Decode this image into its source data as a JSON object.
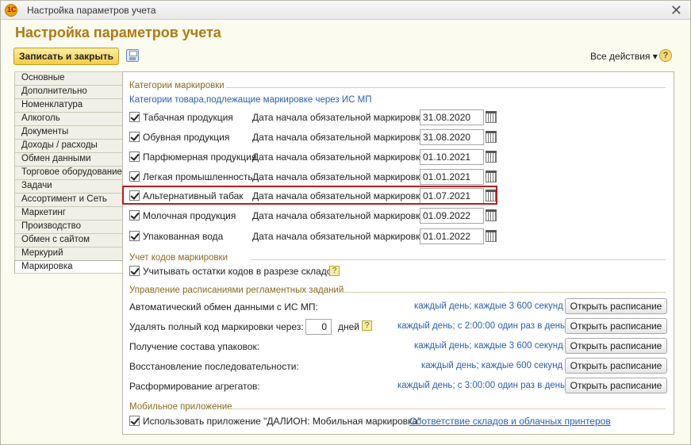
{
  "window": {
    "title": "Настройка параметров учета",
    "logo_text": "1С"
  },
  "page": {
    "title": "Настройка параметров учета"
  },
  "toolbar": {
    "save_close_label": "Записать и закрыть",
    "all_actions_label": "Все действия ▾",
    "help_label": "?"
  },
  "tabs": [
    "Основные",
    "Дополнительно",
    "Номенклатура",
    "Алкоголь",
    "Документы",
    "Доходы / расходы",
    "Обмен данными",
    "Торговое оборудование",
    "Задачи",
    "Ассортимент и Сеть",
    "Маркетинг",
    "Производство",
    "Обмен с сайтом",
    "Меркурий",
    "Маркировка"
  ],
  "active_tab": "Маркировка",
  "categories": {
    "section_title": "Категории маркировки",
    "subtitle": "Категории товара,подлежащие маркировке через ИС МП",
    "date_label": "Дата начала обязательной маркировки:",
    "items": [
      {
        "label": "Табачная продукция",
        "checked": true,
        "date": "31.08.2020"
      },
      {
        "label": "Обувная продукция",
        "checked": true,
        "date": "31.08.2020"
      },
      {
        "label": "Парфюмерная продукция",
        "checked": true,
        "date": "01.10.2021"
      },
      {
        "label": "Легкая промышленность",
        "checked": true,
        "date": "01.01.2021"
      },
      {
        "label": "Альтернативный табак",
        "checked": true,
        "date": "01.07.2021"
      },
      {
        "label": "Молочная продукция",
        "checked": true,
        "date": "01.09.2022"
      },
      {
        "label": "Упакованная вода",
        "checked": true,
        "date": "01.01.2022"
      }
    ]
  },
  "codes_accounting": {
    "section_title": "Учет кодов маркировки",
    "checkbox_label": "Учитывать остатки кодов в разрезе складов",
    "checked": true,
    "hint": "?"
  },
  "schedules": {
    "section_title": "Управление расписаниями регламентных заданий",
    "button_label": "Открыть расписание",
    "days_value": "0",
    "days_unit": "дней",
    "hint": "?",
    "items": [
      {
        "label": "Автоматический обмен данными с ИС МП:",
        "schedule": "каждый день; каждые 3 600 секунд"
      },
      {
        "label": "Удалять полный код маркировки через:",
        "schedule": "каждый день; с 2:00:00 один раз в день"
      },
      {
        "label": "Получение состава упаковок:",
        "schedule": "каждый день; каждые 3 600 секунд"
      },
      {
        "label": "Восстановление последовательности:",
        "schedule": "каждый день; каждые 600 секунд"
      },
      {
        "label": "Расформирование агрегатов:",
        "schedule": "каждый день; с 3:00:00 один раз в день"
      }
    ]
  },
  "mobile": {
    "section_title": "Мобильное приложение",
    "checkbox_label": "Использовать приложение \"ДАЛИОН: Мобильная маркировка\"",
    "checked": true,
    "link_label": "Соответствие складов и облачных принтеров"
  },
  "colors": {
    "title_accent": "#b07a10",
    "link_blue": "#2a5fb3",
    "highlight_red": "#b71d1d",
    "button_yellow": "#f1cc45"
  }
}
